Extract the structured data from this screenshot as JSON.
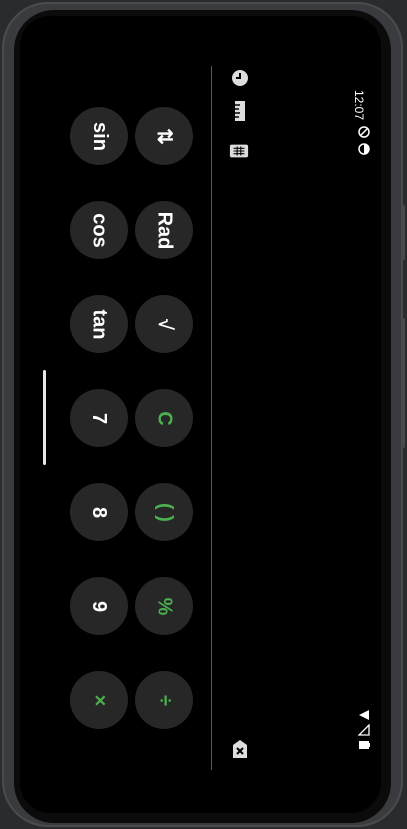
{
  "status_bar": {
    "time": "12:07"
  },
  "toolbar": {
    "history_icon": "clock-icon",
    "unit_icon": "ruler-icon",
    "keypad_icon": "calculator-icon",
    "backspace_icon": "backspace-icon"
  },
  "keys": {
    "sin": "sin",
    "swap": "⇅",
    "cos": "cos",
    "rad": "Rad",
    "tan": "tan",
    "sqrt": "√",
    "seven": "7",
    "clear": "C",
    "eight": "8",
    "parens": "( )",
    "nine": "9",
    "percent": "%",
    "multiply": "×",
    "divide": "÷"
  },
  "colors": {
    "accent": "#4caf50",
    "button_bg": "#272727",
    "screen_bg": "#000000"
  }
}
